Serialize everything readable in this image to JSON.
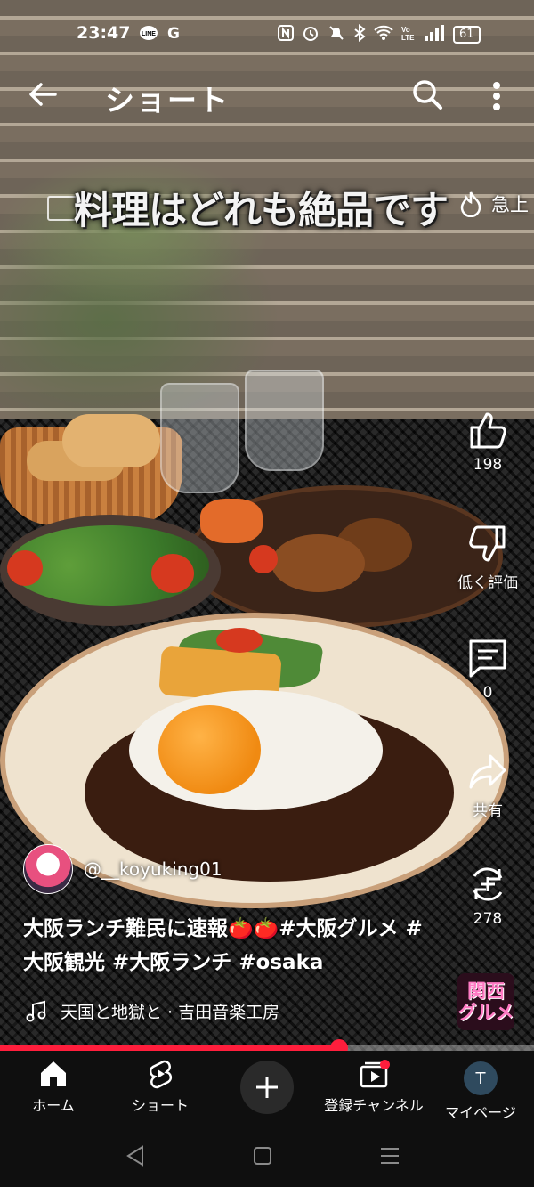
{
  "status_bar": {
    "time": "23:47",
    "left_icons": [
      "line-icon",
      "google-icon"
    ],
    "g_label": "G",
    "battery": "61"
  },
  "header": {
    "title": "ショート"
  },
  "video": {
    "overlay_caption": "料理はどれも絶品です",
    "overlay_right_text": "急上"
  },
  "actions": {
    "like_count": "198",
    "dislike_label": "低く評価",
    "comment_count": "0",
    "share_label": "共有",
    "remix_count": "278"
  },
  "channel": {
    "handle": "@__koyuking01"
  },
  "description": {
    "text": "大阪ランチ難民に速報🍅🍅",
    "hashtags": "#大阪グルメ #大阪観光 #大阪ランチ #osaka"
  },
  "music": {
    "track": "天国と地獄と · 吉田音楽工房"
  },
  "sound_thumb": {
    "line1": "関西",
    "line2": "グルメ"
  },
  "progress": {
    "fraction": 0.635
  },
  "bottom_nav": {
    "home": "ホーム",
    "shorts": "ショート",
    "subscriptions": "登録チャンネル",
    "mypage": "マイページ",
    "avatar_letter": "T"
  },
  "colors": {
    "accent": "#ff1e3c",
    "nav_background": "#0f0f0f"
  }
}
